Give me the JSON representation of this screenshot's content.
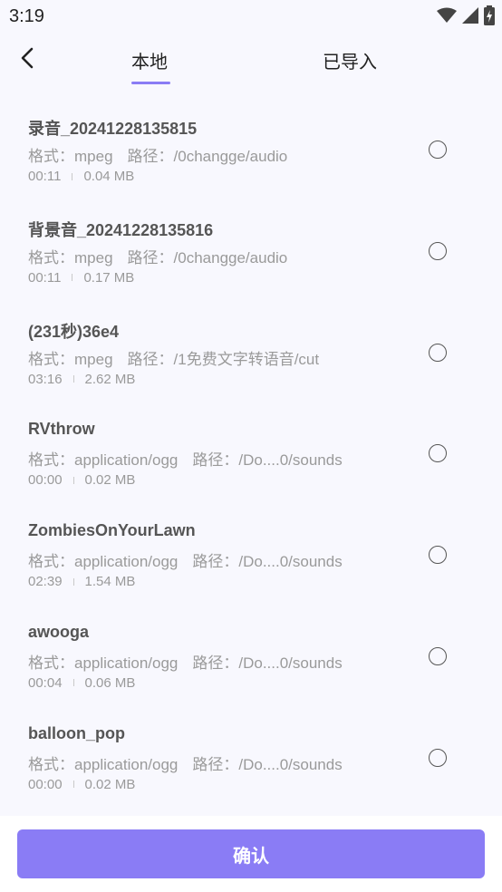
{
  "status_bar": {
    "time": "3:19",
    "icons": [
      "wifi-icon",
      "signal-icon",
      "battery-icon"
    ]
  },
  "header": {
    "back_icon": "chevron-left-icon",
    "tabs": [
      {
        "label": "本地",
        "active": true
      },
      {
        "label": "已导入",
        "active": false
      }
    ],
    "accent_color": "#8a7cf5"
  },
  "files": [
    {
      "title": "录音_20241228135815",
      "format_label": "格式：",
      "format": "mpeg",
      "path_label": "路径：",
      "path": "/0changge/audio",
      "duration": "00:11",
      "size": "0.04 MB"
    },
    {
      "title": "背景音_20241228135816",
      "format_label": "格式：",
      "format": "mpeg",
      "path_label": "路径：",
      "path": "/0changge/audio",
      "duration": "00:11",
      "size": "0.17 MB"
    },
    {
      "title": "(231秒)36e4",
      "format_label": "格式：",
      "format": "mpeg",
      "path_label": "路径：",
      "path": "/1免费文字转语音/cut",
      "duration": "03:16",
      "size": "2.62 MB"
    },
    {
      "title": "RVthrow",
      "format_label": "格式：",
      "format": "application/ogg",
      "path_label": "路径：",
      "path": "/Do....0/sounds",
      "duration": "00:00",
      "size": "0.02 MB"
    },
    {
      "title": "ZombiesOnYourLawn",
      "format_label": "格式：",
      "format": "application/ogg",
      "path_label": "路径：",
      "path": "/Do....0/sounds",
      "duration": "02:39",
      "size": "1.54 MB"
    },
    {
      "title": "awooga",
      "format_label": "格式：",
      "format": "application/ogg",
      "path_label": "路径：",
      "path": "/Do....0/sounds",
      "duration": "00:04",
      "size": "0.06 MB"
    },
    {
      "title": "balloon_pop",
      "format_label": "格式：",
      "format": "application/ogg",
      "path_label": "路径：",
      "path": "/Do....0/sounds",
      "duration": "00:00",
      "size": "0.02 MB"
    }
  ],
  "footer": {
    "confirm_label": "确认",
    "button_color": "#8a7cf5"
  }
}
